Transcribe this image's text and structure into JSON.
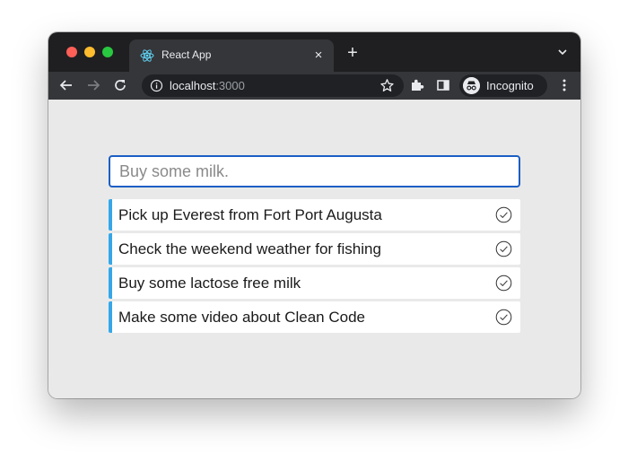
{
  "browser": {
    "tab": {
      "title": "React App",
      "favicon": "react-icon",
      "close_label": "×"
    },
    "new_tab_label": "+",
    "address_bar": {
      "host": "localhost",
      "port": ":3000"
    },
    "profile_label": "Incognito",
    "icons": [
      "back-arrow-icon",
      "forward-arrow-icon",
      "reload-icon",
      "info-icon",
      "star-icon",
      "extensions-icon",
      "side-panel-icon",
      "incognito-icon",
      "more-menu-icon",
      "chevron-down-icon"
    ]
  },
  "app": {
    "input": {
      "placeholder": "Buy some milk.",
      "value": ""
    },
    "todos": [
      {
        "text": "Pick up Everest from Fort Port Augusta"
      },
      {
        "text": "Check the weekend weather for fishing"
      },
      {
        "text": "Buy some lactose free milk"
      },
      {
        "text": "Make some video about Clean Code"
      }
    ]
  },
  "colors": {
    "accent": "#35a7e8",
    "input_border": "#1c5fc4",
    "content_bg": "#e9e9e9",
    "chrome_dark": "#1f1f21",
    "toolbar": "#35363a"
  }
}
